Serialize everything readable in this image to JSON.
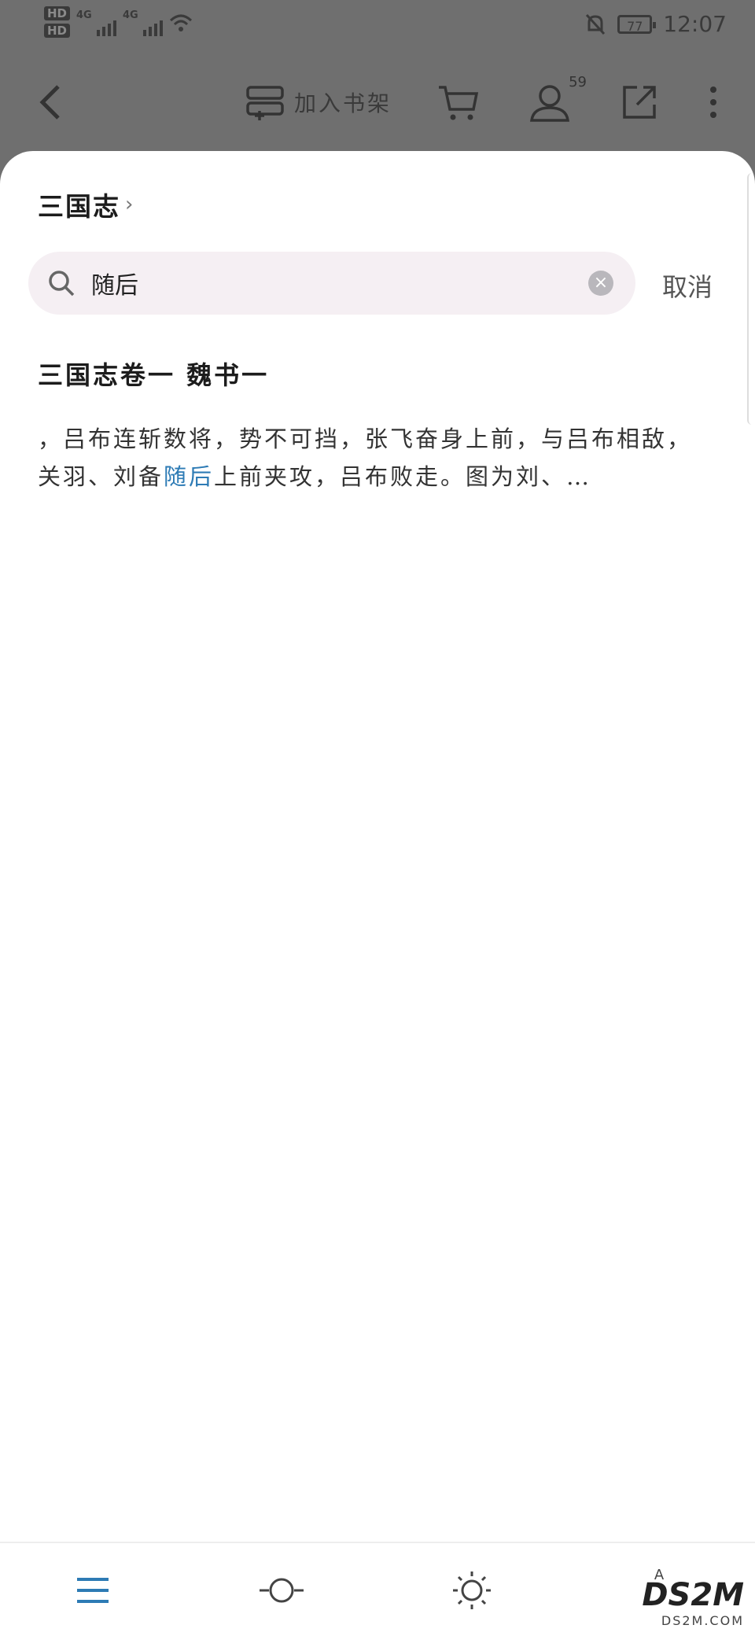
{
  "status_bar": {
    "hd1": "HD",
    "hd2": "HD",
    "net1": "4G",
    "net2": "4G",
    "battery": "77",
    "time": "12:07"
  },
  "toolbar": {
    "add_shelf_label": "加入书架",
    "profile_badge": "59"
  },
  "sheet": {
    "book_title": "三国志",
    "search": {
      "value": "随后"
    },
    "cancel_label": "取消",
    "result": {
      "title": "三国志卷一  魏书一",
      "snippet_before": "，吕布连斩数将，势不可挡，张飞奋身上前，与吕布相敌，关羽、刘备",
      "snippet_highlight": "随后",
      "snippet_after": "上前夹攻，吕布败走。图为刘、…"
    }
  },
  "bottom_bar": {
    "items": [
      "menu-icon",
      "progress-icon",
      "brightness-icon",
      "font-icon"
    ]
  },
  "watermark": {
    "main": "DS2M",
    "sub": "DS2M.COM"
  },
  "colors": {
    "accent": "#2d7bb5",
    "overlay": "#6f6f6f",
    "search_bg": "#f5eff3"
  }
}
